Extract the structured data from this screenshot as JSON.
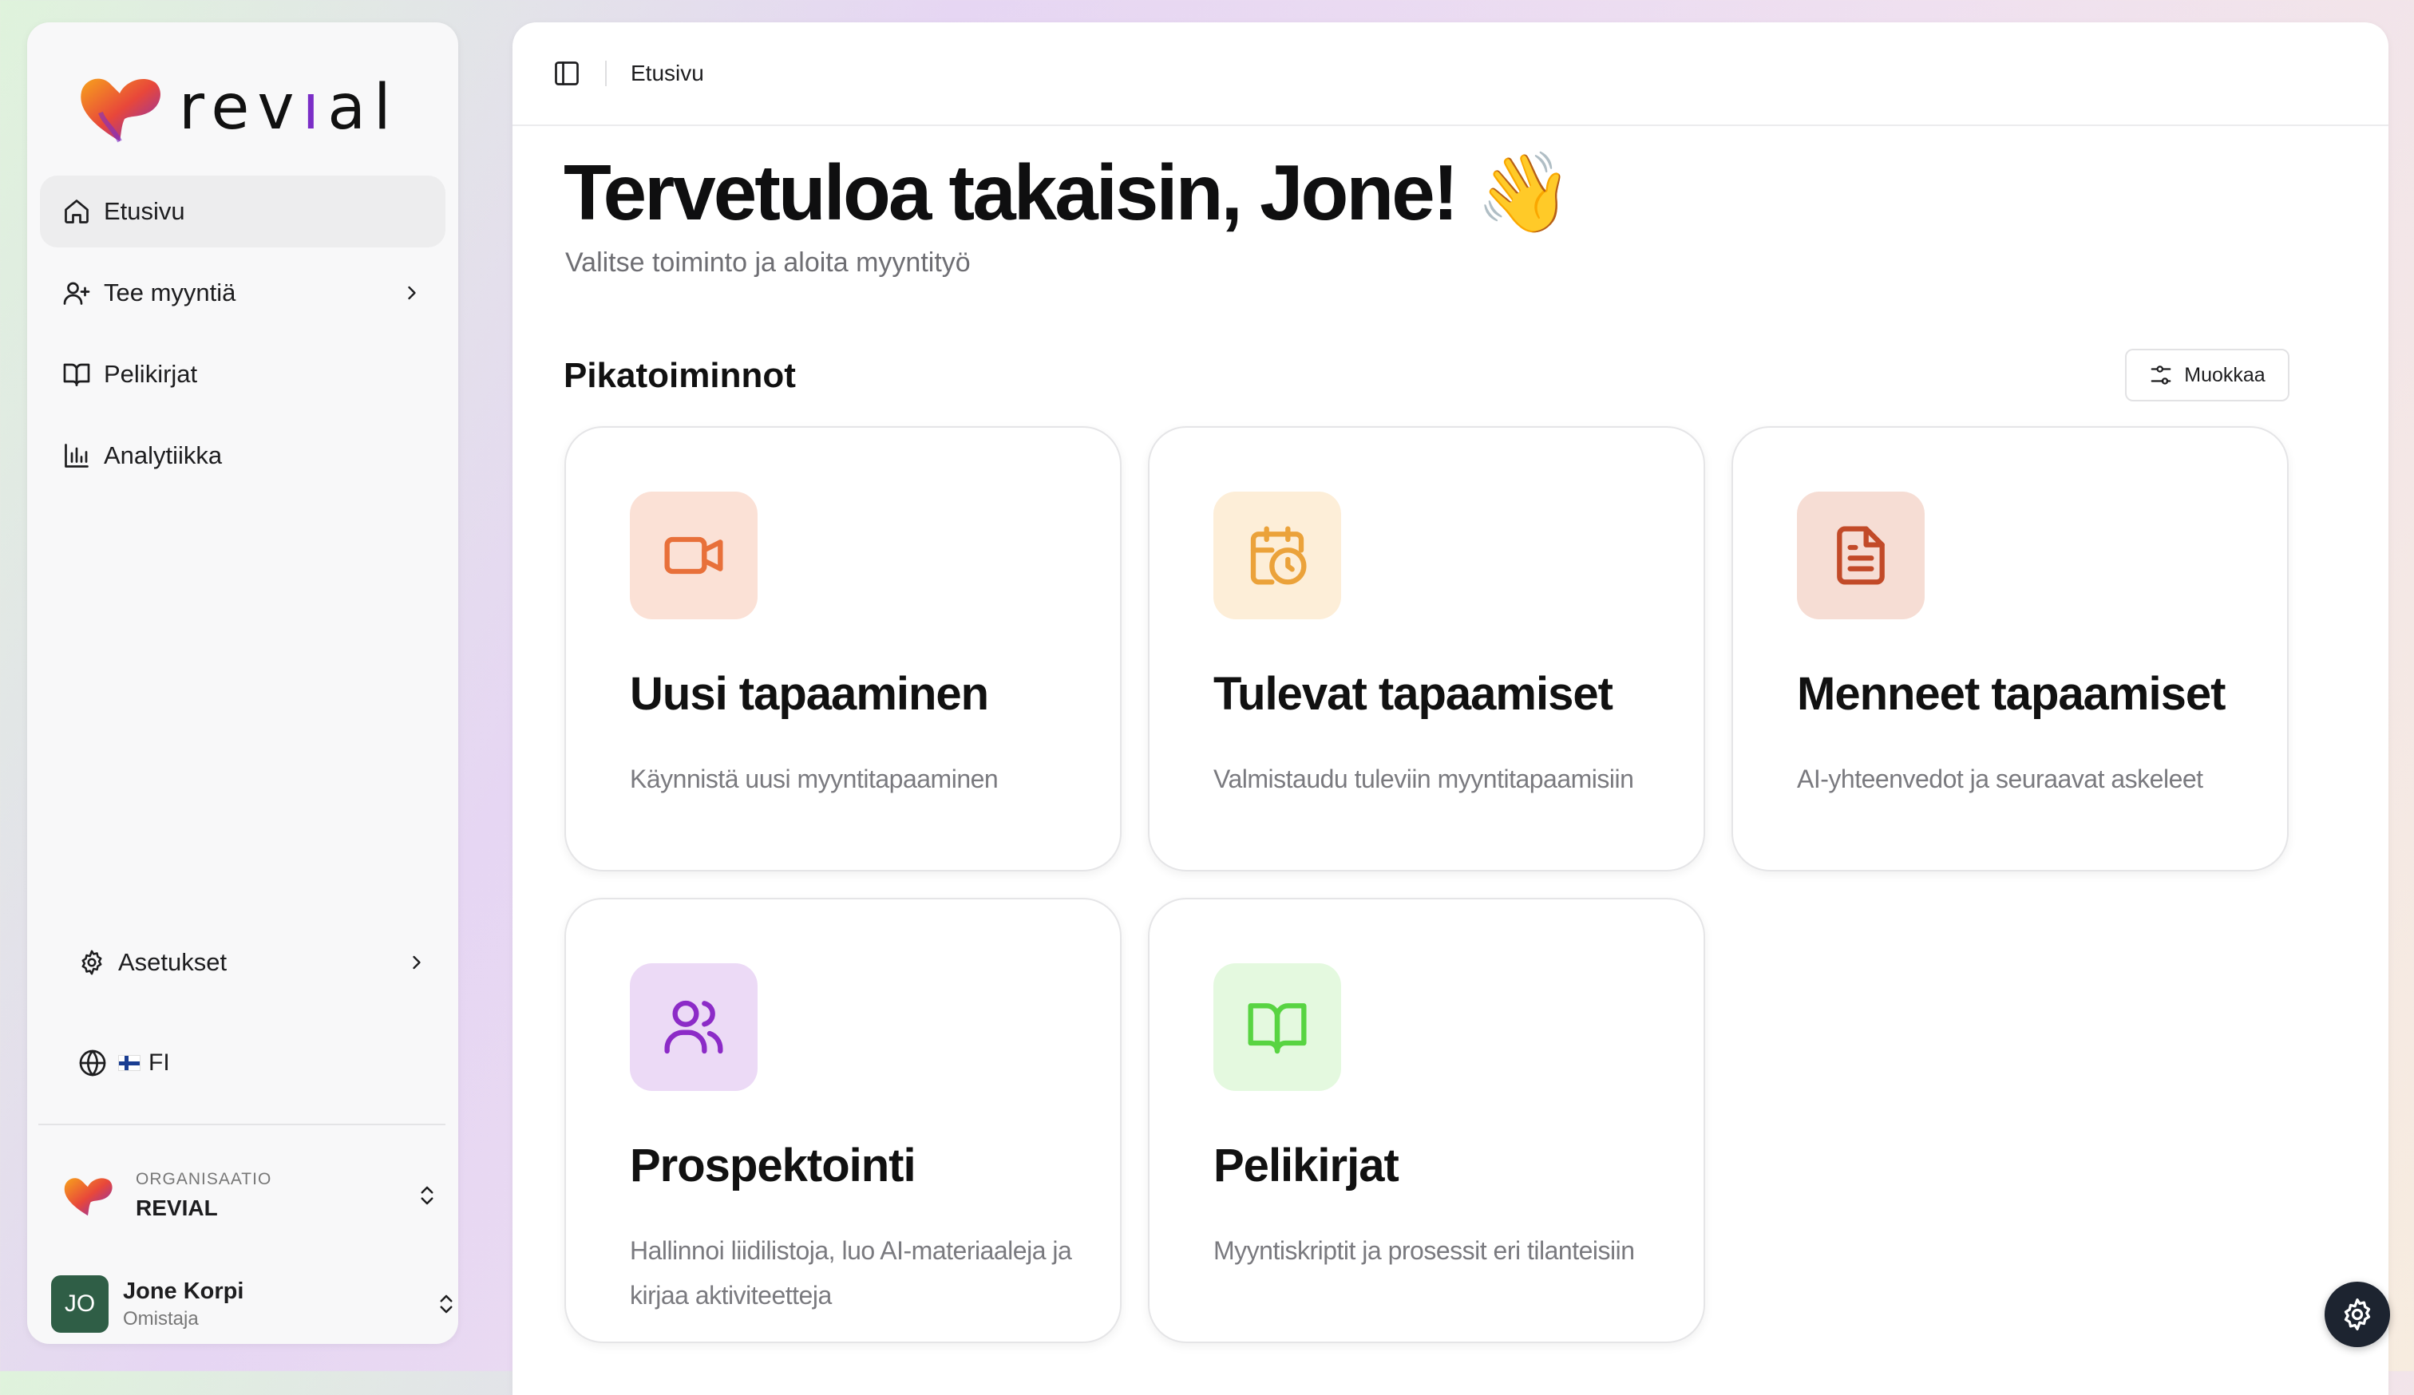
{
  "sidebar": {
    "brand": {
      "text_pre": "rev",
      "text_accent": "ı",
      "text_post": "al"
    },
    "nav": [
      {
        "label": "Etusivu",
        "icon": "home-icon",
        "active": true
      },
      {
        "label": "Tee myyntiä",
        "icon": "user-plus-icon",
        "has_submenu": true
      },
      {
        "label": "Pelikirjat",
        "icon": "book-open-icon"
      },
      {
        "label": "Analytiikka",
        "icon": "bar-chart-icon"
      }
    ],
    "settings": {
      "label": "Asetukset",
      "icon": "gear-icon"
    },
    "language": {
      "label": "FI",
      "icon": "globe-icon",
      "flag": "finland-flag"
    },
    "organization": {
      "caption": "ORGANISAATIO",
      "name": "REVIAL"
    },
    "user": {
      "initials": "JO",
      "name": "Jone Korpi",
      "role": "Omistaja",
      "avatar_color": "#2f5e46"
    }
  },
  "topbar": {
    "breadcrumb": "Etusivu"
  },
  "main": {
    "welcome": "Tervetuloa takaisin, Jone! 👋",
    "subtitle": "Valitse toiminto ja aloita myyntityö",
    "section_title": "Pikatoiminnot",
    "edit_label": "Muokkaa",
    "cards": [
      {
        "title": "Uusi tapaaminen",
        "desc": "Käynnistä uusi myyntitapaaminen",
        "icon": "video-camera-icon",
        "tile_color": "#fbe1d6",
        "icon_color": "#e8703a"
      },
      {
        "title": "Tulevat tapaamiset",
        "desc": "Valmistaudu tuleviin myyntitapaamisiin",
        "icon": "calendar-clock-icon",
        "tile_color": "#fdeed8",
        "icon_color": "#eba23a"
      },
      {
        "title": "Menneet tapaamiset",
        "desc": "AI-yhteenvedot ja seuraavat askeleet",
        "icon": "file-text-icon",
        "tile_color": "#f6ddd4",
        "icon_color": "#c24a28"
      },
      {
        "title": "Prospektointi",
        "desc": "Hallinnoi liidilistoja, luo AI-materiaaleja ja kirjaa aktiviteetteja",
        "icon": "users-icon",
        "tile_color": "#ecdaf6",
        "icon_color": "#8c2bc7"
      },
      {
        "title": "Pelikirjat",
        "desc": "Myyntiskriptit ja prosessit eri tilanteisiin",
        "icon": "book-open-icon",
        "tile_color": "#e4f9df",
        "icon_color": "#58d442"
      }
    ]
  },
  "colors": {
    "accent": "#7b2ec7",
    "fab": "#1d2430"
  }
}
